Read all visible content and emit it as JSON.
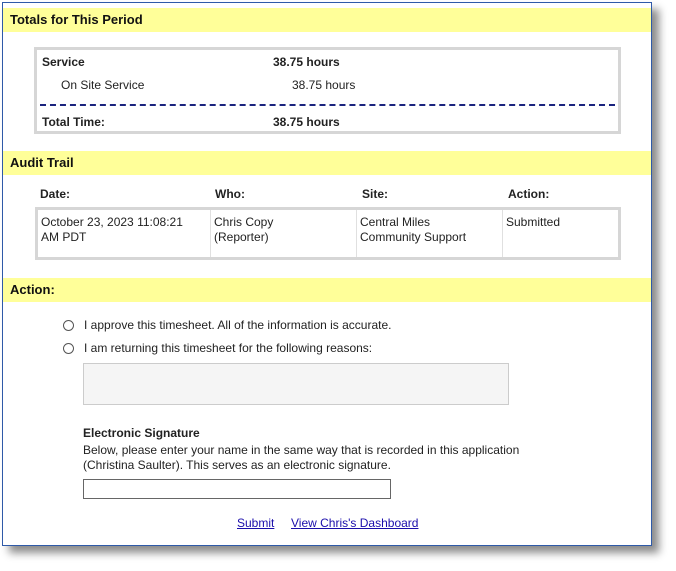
{
  "totals": {
    "header": "Totals for This Period",
    "service_label": "Service",
    "service_value": "38.75 hours",
    "onsite_label": "On Site Service",
    "onsite_value": "38.75 hours",
    "total_label": "Total Time:",
    "total_value": "38.75 hours"
  },
  "audit": {
    "header": "Audit Trail",
    "columns": [
      "Date:",
      "Who:",
      "Site:",
      "Action:"
    ],
    "rows": [
      {
        "date_line1": "October 23, 2023 11:08:21",
        "date_line2": "AM PDT",
        "who_line1": "Chris Copy",
        "who_line2": "(Reporter)",
        "site_line1": "Central Miles",
        "site_line2": "Community Support",
        "action": "Submitted"
      }
    ]
  },
  "action": {
    "header": "Action:",
    "approve_label": "I approve this timesheet. All of the information is accurate.",
    "return_label": "I am returning this timesheet for the following reasons:",
    "signature_title": "Electronic Signature",
    "signature_line1": "Below, please enter your name in the same way that is recorded in this application",
    "signature_line2": "(Christina Saulter). This serves as an electronic signature.",
    "reason_value": "",
    "signature_value": "",
    "submit_label": "Submit",
    "dashboard_label": "View Chris's Dashboard"
  },
  "colors": {
    "header_bg": "#ffff99",
    "frame_border": "#2f5aa8",
    "dash_line": "#1a237e",
    "link": "#1a0dab"
  }
}
